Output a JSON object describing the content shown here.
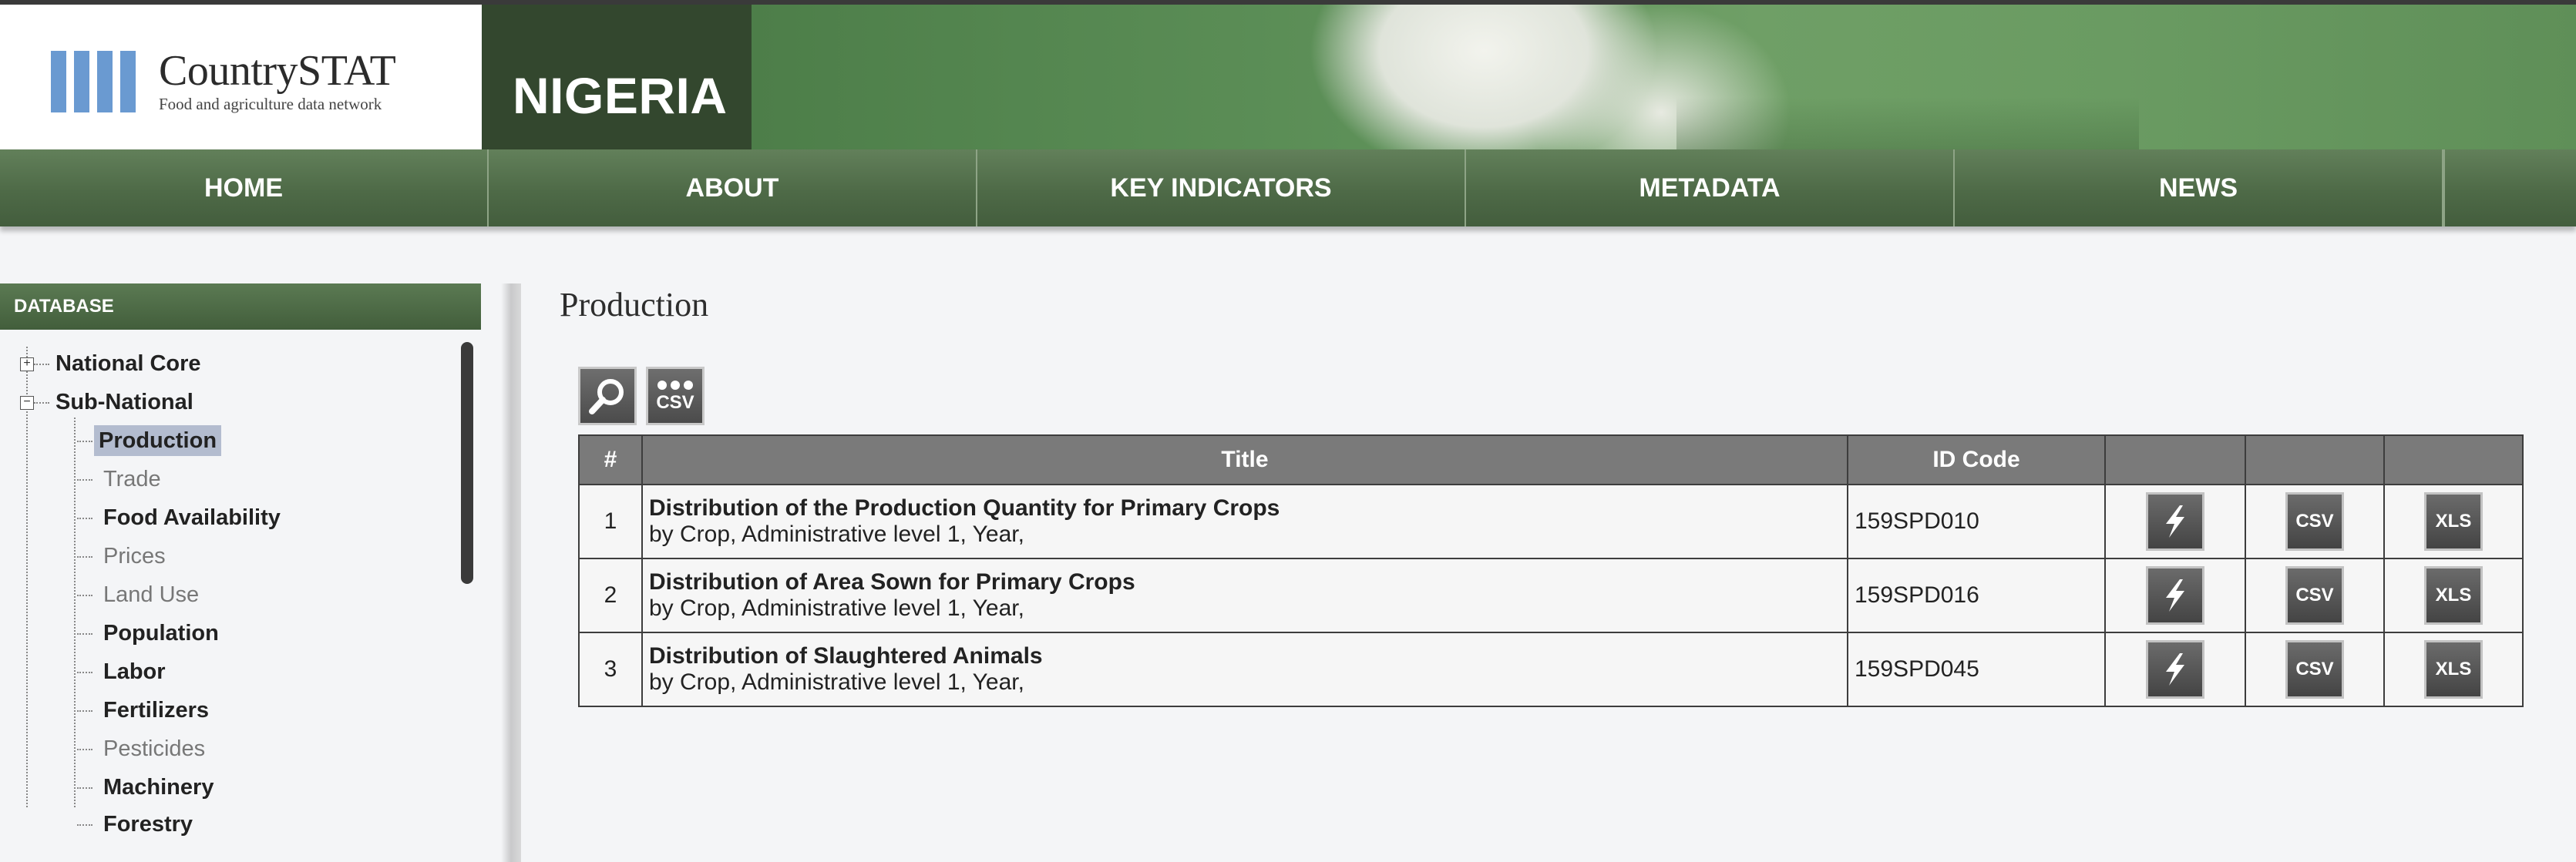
{
  "header": {
    "logo_title": "CountrySTAT",
    "logo_subtitle": "Food and agriculture data network",
    "country": "NIGERIA"
  },
  "nav": {
    "items": [
      {
        "label": "HOME"
      },
      {
        "label": "ABOUT"
      },
      {
        "label": "KEY INDICATORS"
      },
      {
        "label": "METADATA"
      },
      {
        "label": "NEWS"
      }
    ]
  },
  "sidebar": {
    "header": "DATABASE",
    "top_items": [
      {
        "label": "National Core",
        "expander": "+"
      },
      {
        "label": "Sub-National",
        "expander": "−"
      }
    ],
    "children": [
      {
        "label": "Production"
      },
      {
        "label": "Trade"
      },
      {
        "label": "Food Availability"
      },
      {
        "label": "Prices"
      },
      {
        "label": "Land Use"
      },
      {
        "label": "Population"
      },
      {
        "label": "Labor"
      },
      {
        "label": "Fertilizers"
      },
      {
        "label": "Pesticides"
      },
      {
        "label": "Machinery"
      },
      {
        "label": "Forestry"
      }
    ]
  },
  "main": {
    "title": "Production",
    "toolbar": {
      "csv_label": "CSV",
      "search_icon": "magnifier-icon",
      "csv_icon": "csv-dots-icon"
    },
    "table": {
      "headers": [
        "#",
        "Title",
        "ID Code",
        "",
        "",
        ""
      ],
      "rows": [
        {
          "num": "1",
          "title": "Distribution of the Production Quantity for Primary Crops",
          "subtitle": "by Crop, Administrative level 1, Year,",
          "id": "159SPD010"
        },
        {
          "num": "2",
          "title": "Distribution of Area Sown for Primary Crops",
          "subtitle": "by Crop, Administrative level 1, Year,",
          "id": "159SPD016"
        },
        {
          "num": "3",
          "title": "Distribution of Slaughtered Animals",
          "subtitle": "by Crop, Administrative level 1, Year,",
          "id": "159SPD045"
        }
      ],
      "buttons": {
        "csv": "CSV",
        "xls": "XLS",
        "quick_icon": "lightning-icon"
      }
    }
  },
  "colors": {
    "nav_green": "#4e6a47",
    "country_box": "#33472e",
    "logo_blue": "#6a9ad1",
    "table_header": "#7a7a7a",
    "selected_bg": "#b3bccf"
  }
}
